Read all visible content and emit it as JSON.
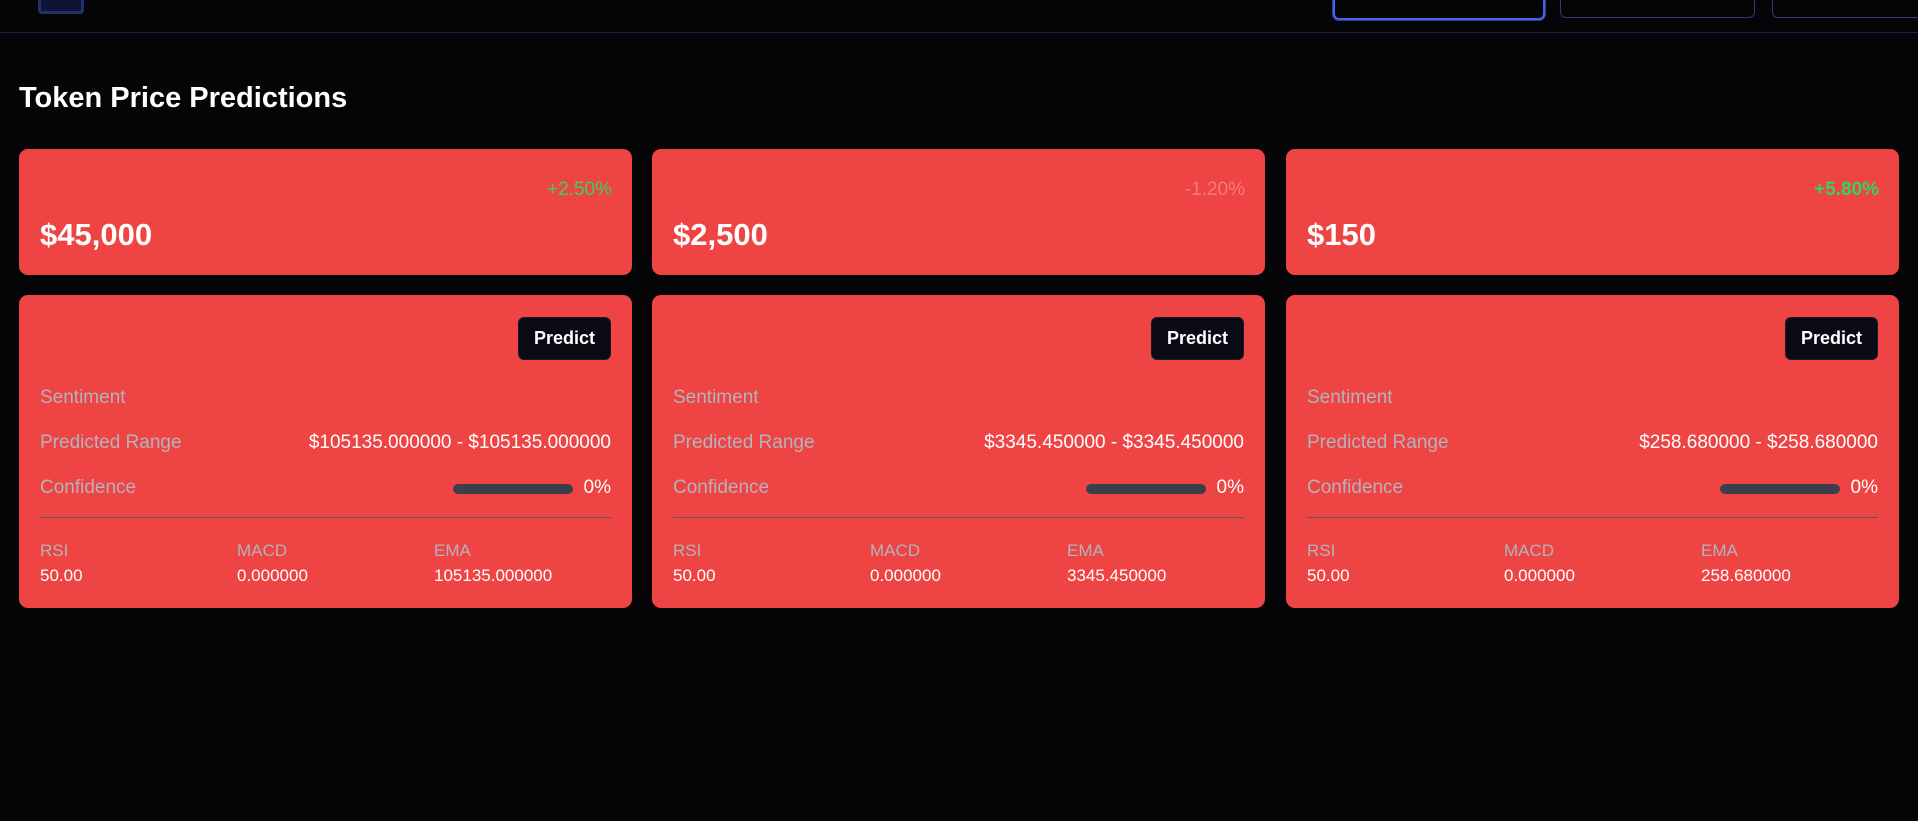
{
  "colors": {
    "background": "#050508",
    "card": "#ef4444",
    "positive": "#35d35f",
    "negative": "#f77b7b",
    "button": "#0a0a14",
    "confidence_track": "#3a3f4b"
  },
  "title": "Token Price Predictions",
  "tokens": [
    {
      "change": "+2.50%",
      "price": "$45,000",
      "predict_label": "Predict",
      "sentiment_label": "Sentiment",
      "range_label": "Predicted Range",
      "range_value": "$105135.000000 - $105135.000000",
      "confidence_label": "Confidence",
      "confidence_value": "0%",
      "confidence_fraction": 0,
      "rsi_label": "RSI",
      "rsi_value": "50.00",
      "macd_label": "MACD",
      "macd_value": "0.000000",
      "ema_label": "EMA",
      "ema_value": "105135.000000"
    },
    {
      "change": "-1.20%",
      "price": "$2,500",
      "predict_label": "Predict",
      "sentiment_label": "Sentiment",
      "range_label": "Predicted Range",
      "range_value": "$3345.450000 - $3345.450000",
      "confidence_label": "Confidence",
      "confidence_value": "0%",
      "confidence_fraction": 0,
      "rsi_label": "RSI",
      "rsi_value": "50.00",
      "macd_label": "MACD",
      "macd_value": "0.000000",
      "ema_label": "EMA",
      "ema_value": "3345.450000"
    },
    {
      "change": "+5.80%",
      "price": "$150",
      "predict_label": "Predict",
      "sentiment_label": "Sentiment",
      "range_label": "Predicted Range",
      "range_value": "$258.680000 - $258.680000",
      "confidence_label": "Confidence",
      "confidence_value": "0%",
      "confidence_fraction": 0,
      "rsi_label": "RSI",
      "rsi_value": "50.00",
      "macd_label": "MACD",
      "macd_value": "0.000000",
      "ema_label": "EMA",
      "ema_value": "258.680000"
    }
  ]
}
